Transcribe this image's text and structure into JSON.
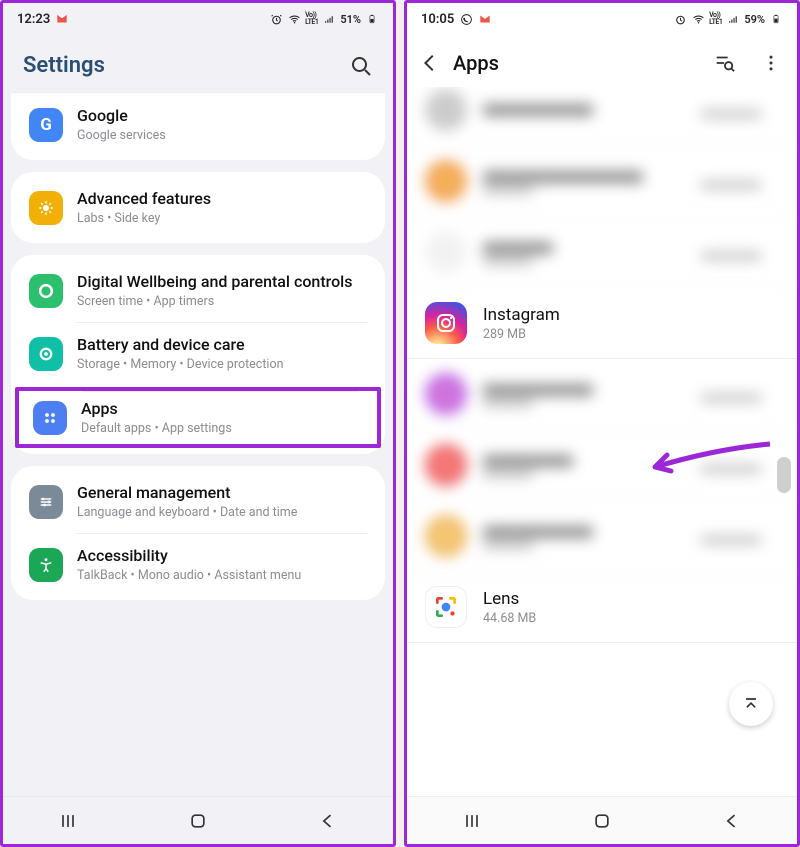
{
  "left": {
    "status": {
      "time": "12:23",
      "battery": "51%",
      "net": "Vo))",
      "lte": "LTE1"
    },
    "header": {
      "title": "Settings"
    },
    "groups": [
      {
        "rows": [
          {
            "icon": "google",
            "title": "Google",
            "sub": "Google services"
          }
        ]
      },
      {
        "rows": [
          {
            "icon": "adv",
            "title": "Advanced features",
            "sub": "Labs  •  Side key"
          }
        ]
      },
      {
        "rows": [
          {
            "icon": "dw",
            "title": "Digital Wellbeing and parental controls",
            "sub": "Screen time  •  App timers"
          },
          {
            "icon": "batt",
            "title": "Battery and device care",
            "sub": "Storage  •  Memory  •  Device protection"
          },
          {
            "icon": "apps",
            "title": "Apps",
            "sub": "Default apps  •  App settings",
            "highlight": true
          }
        ]
      },
      {
        "rows": [
          {
            "icon": "gm",
            "title": "General management",
            "sub": "Language and keyboard  •  Date and time"
          },
          {
            "icon": "acc",
            "title": "Accessibility",
            "sub": "TalkBack  •  Mono audio  •  Assistant menu"
          }
        ]
      }
    ]
  },
  "right": {
    "status": {
      "time": "10:05",
      "battery": "59%",
      "net": "Vo))",
      "lte": "LTE1"
    },
    "header": {
      "title": "Apps"
    },
    "focused": {
      "name": "Instagram",
      "size": "289 MB"
    },
    "lens": {
      "name": "Lens",
      "size": "44.68 MB"
    }
  }
}
